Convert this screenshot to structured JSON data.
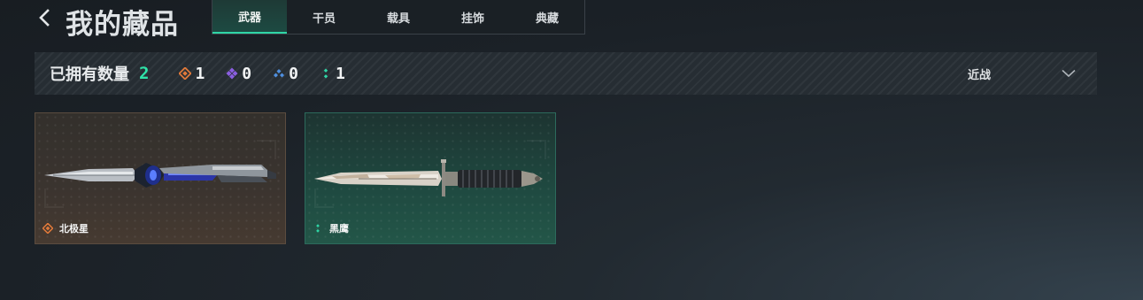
{
  "header": {
    "back_icon": "chevron-left-icon",
    "title": "我的藏品",
    "tabs": [
      {
        "label": "武器",
        "active": true
      },
      {
        "label": "干员",
        "active": false
      },
      {
        "label": "载具",
        "active": false
      },
      {
        "label": "挂饰",
        "active": false
      },
      {
        "label": "典藏",
        "active": false
      }
    ]
  },
  "stats": {
    "owned_label": "已拥有数量",
    "owned_total": "2",
    "rarities": [
      {
        "icon": "orange-diamond-icon",
        "color": "#e0793a",
        "count": "1"
      },
      {
        "icon": "purple-diamond-icon",
        "color": "#8a5ee0",
        "count": "0"
      },
      {
        "icon": "blue-diamond-icon",
        "color": "#4f8fe0",
        "count": "0"
      },
      {
        "icon": "green-dots-icon",
        "color": "#2fd6a6",
        "count": "1"
      }
    ],
    "filter": {
      "label": "近战",
      "icon": "chevron-down-icon"
    }
  },
  "items": [
    {
      "name": "北极星",
      "rarity": "orange",
      "rarity_color": "#e0793a",
      "image": "combat-dagger-blue-gem"
    },
    {
      "name": "黑鹰",
      "rarity": "green",
      "rarity_color": "#2fd6a6",
      "image": "combat-knife-black-handle"
    }
  ],
  "colors": {
    "accent": "#2fd6a6",
    "background": "#1b2127"
  }
}
